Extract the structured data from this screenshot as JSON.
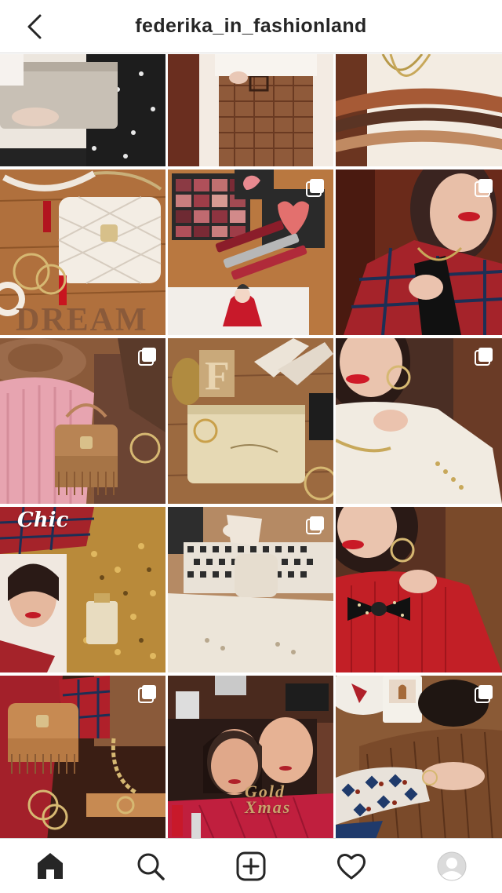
{
  "header": {
    "username": "federika_in_fashionland",
    "back_icon": "chevron-left-icon"
  },
  "grid": {
    "tiles": [
      {
        "name": "post-pouch-polka",
        "multi": false,
        "colors": [
          "#a8a8a8",
          "#d9c9b2",
          "#2b2b2b"
        ]
      },
      {
        "name": "post-gingham-skirt",
        "multi": false,
        "colors": [
          "#8b5a3c",
          "#f2e8e0",
          "#6b3b26"
        ]
      },
      {
        "name": "post-striped-sweater",
        "multi": false,
        "colors": [
          "#f5efe6",
          "#a0522d",
          "#5b3a29"
        ]
      },
      {
        "name": "post-quilted-bag-flatlay",
        "multi": false,
        "colors": [
          "#b5733f",
          "#f2ece4",
          "#c21c2c"
        ]
      },
      {
        "name": "post-makeup-palette",
        "multi": true,
        "colors": [
          "#b4763f",
          "#7a2b3a",
          "#e8dfd8"
        ]
      },
      {
        "name": "post-tartan-jacket",
        "multi": true,
        "colors": [
          "#8b2f22",
          "#2d1f1a",
          "#b53a3a"
        ]
      },
      {
        "name": "post-pink-sweater-hat",
        "multi": true,
        "colors": [
          "#e7a4b0",
          "#9b6b4b",
          "#6b4433"
        ]
      },
      {
        "name": "post-gold-pouch",
        "multi": false,
        "colors": [
          "#9c6a40",
          "#e6d9b4",
          "#efe8de"
        ]
      },
      {
        "name": "post-cream-turtleneck",
        "multi": true,
        "colors": [
          "#f0ebe2",
          "#3a2a26",
          "#c8252d"
        ]
      },
      {
        "name": "post-chic-sequins",
        "multi": false,
        "colors": [
          "#c4953f",
          "#b3242c",
          "#2a1a16"
        ],
        "caption": "Chic"
      },
      {
        "name": "post-houndstooth-knit",
        "multi": true,
        "colors": [
          "#e9e2d7",
          "#2d2d2d",
          "#b58a64"
        ]
      },
      {
        "name": "post-red-sweater-bow",
        "multi": false,
        "colors": [
          "#c21f26",
          "#4a2e22",
          "#111111"
        ]
      },
      {
        "name": "post-fringe-bag-tartan",
        "multi": true,
        "colors": [
          "#3a1e14",
          "#a3202a",
          "#c78a52"
        ]
      },
      {
        "name": "post-gold-xmas-magazine",
        "multi": false,
        "colors": [
          "#6b3d2b",
          "#c01f3e",
          "#c8a35a"
        ],
        "caption": "Gold Xmas"
      },
      {
        "name": "post-patterned-dress",
        "multi": true,
        "colors": [
          "#e8e2da",
          "#1f3a6b",
          "#7a4a2a"
        ]
      }
    ]
  },
  "navbar": {
    "items": [
      {
        "name": "nav-home",
        "icon": "home-icon"
      },
      {
        "name": "nav-search",
        "icon": "search-icon"
      },
      {
        "name": "nav-create",
        "icon": "plus-square-icon"
      },
      {
        "name": "nav-activity",
        "icon": "heart-icon"
      },
      {
        "name": "nav-profile",
        "icon": "avatar-icon"
      }
    ]
  }
}
